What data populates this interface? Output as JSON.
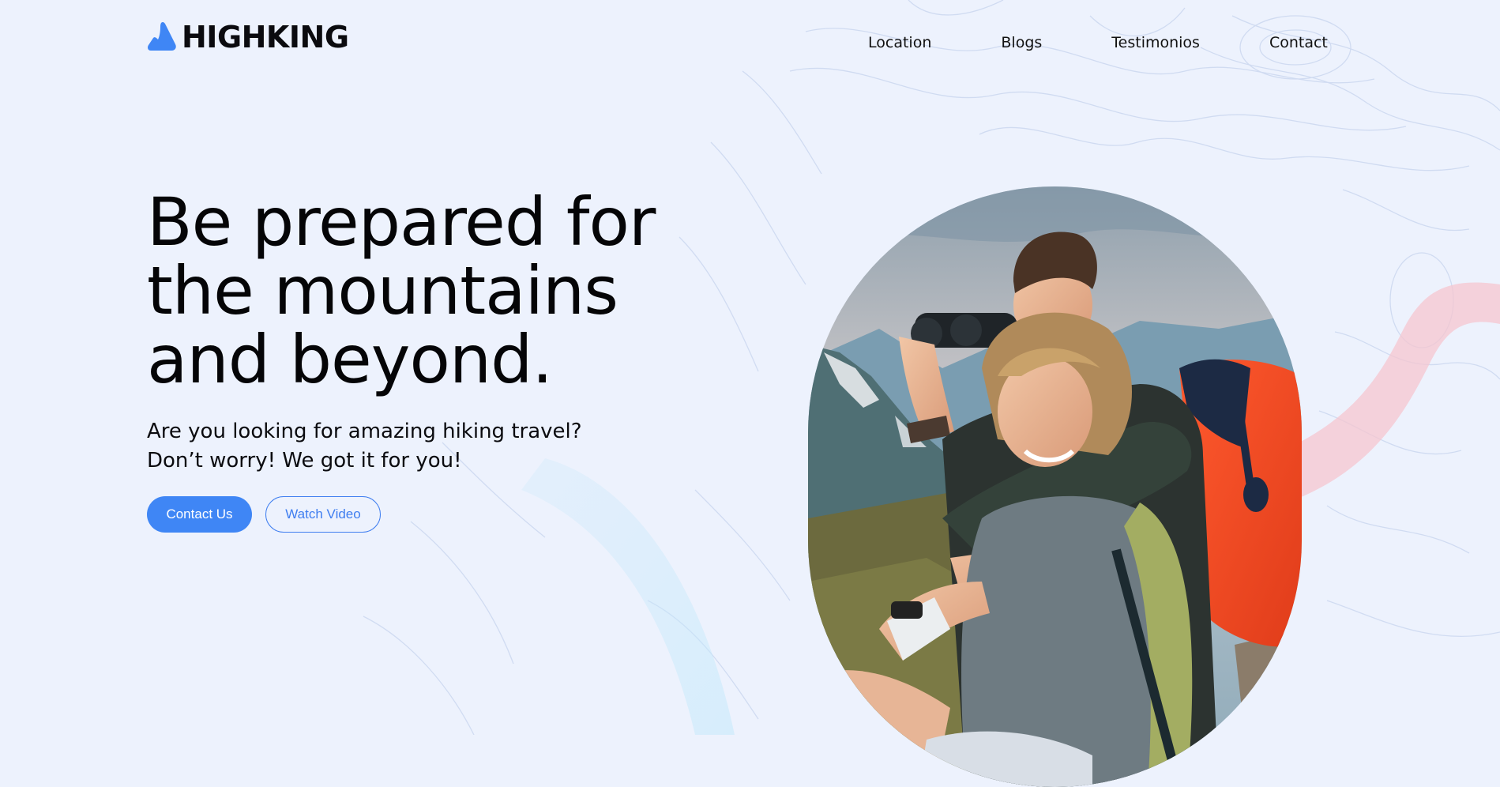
{
  "brand": {
    "name": "HIGHKING",
    "logo_icon": "mountain-icon",
    "accent_color": "#3f86f5"
  },
  "nav": {
    "items": [
      "Location",
      "Blogs",
      "Testimonios",
      "Contact"
    ]
  },
  "hero": {
    "title_lines": [
      "Be prepared for",
      "the mountains",
      "and beyond."
    ],
    "subtitle_lines": [
      "Are you looking for amazing hiking travel?",
      "Don’t worry! We got it for you!"
    ],
    "primary_button": "Contact Us",
    "secondary_button": "Watch Video"
  },
  "image": {
    "content": "photo-hikers-icon"
  }
}
